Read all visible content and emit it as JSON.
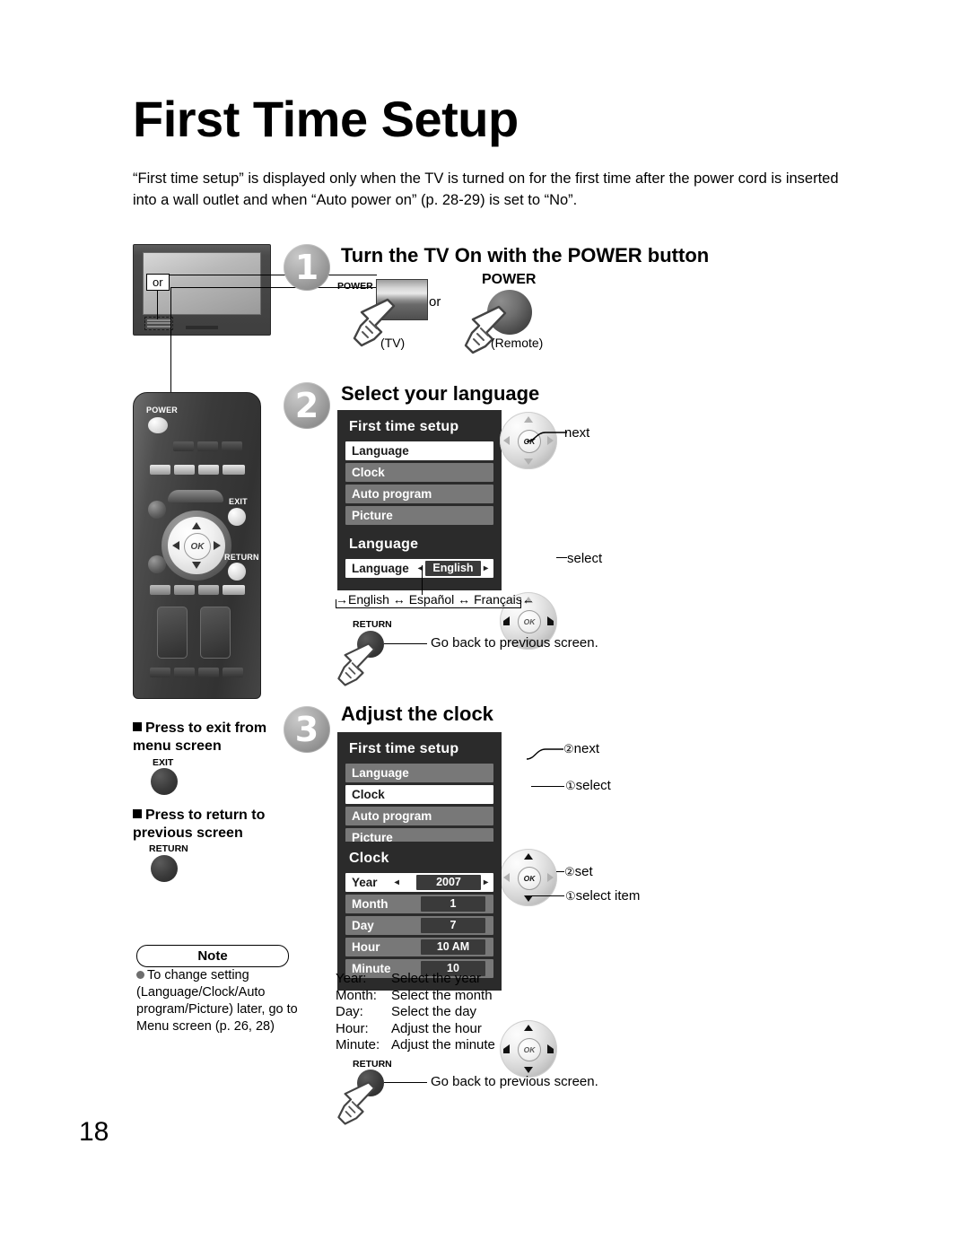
{
  "page": {
    "title": "First Time Setup",
    "intro": "“First time setup” is displayed only when the TV is turned on for the first time after the power cord is inserted into a wall outlet and when “Auto power on” (p. 28-29) is set to “No”.",
    "number": "18"
  },
  "steps": [
    {
      "num": "1",
      "title": "Turn the TV On with the POWER button"
    },
    {
      "num": "2",
      "title": "Select your language"
    },
    {
      "num": "3",
      "title": "Adjust the clock"
    }
  ],
  "step1": {
    "tv_or_label": "or",
    "tv_power_label": "POWER",
    "tv_caption": "(TV)",
    "or_text": "or",
    "remote_power_label": "POWER",
    "remote_caption": "(Remote)"
  },
  "step2": {
    "menu": {
      "title": "First time setup",
      "rows": [
        {
          "label": "Language",
          "selected": true
        },
        {
          "label": "Clock",
          "selected": false
        },
        {
          "label": "Auto program",
          "selected": false
        },
        {
          "label": "Picture",
          "selected": false
        }
      ]
    },
    "dpad_annotation": "next",
    "language_panel": {
      "title": "Language",
      "row_label": "Language",
      "row_value": "English",
      "left_arrow": "◂",
      "right_arrow": "▸"
    },
    "dpad_annotation2": "select",
    "language_chain": "English ↔ Español ↔ Français",
    "chain_in": "→",
    "chain_out": "←",
    "return_label": "RETURN",
    "return_text": "Go back to previous screen."
  },
  "step3": {
    "menu": {
      "title": "First time setup",
      "rows": [
        {
          "label": "Language",
          "selected": false
        },
        {
          "label": "Clock",
          "selected": true
        },
        {
          "label": "Auto program",
          "selected": false
        },
        {
          "label": "Picture",
          "selected": false
        }
      ]
    },
    "dpad_annotations": [
      {
        "num": "②",
        "text": "next"
      },
      {
        "num": "①",
        "text": "select"
      }
    ],
    "clock_panel": {
      "title": "Clock",
      "rows": [
        {
          "label": "Year",
          "value": "2007",
          "selected": true
        },
        {
          "label": "Month",
          "value": "1",
          "selected": false
        },
        {
          "label": "Day",
          "value": "7",
          "selected": false
        },
        {
          "label": "Hour",
          "value": "10 AM",
          "selected": false
        },
        {
          "label": "Minute",
          "value": "10",
          "selected": false
        }
      ]
    },
    "clock_dpad_annotations": [
      {
        "num": "②",
        "text": "set"
      },
      {
        "num": "①",
        "text": "select item"
      }
    ],
    "descriptions": [
      {
        "term": "Year:",
        "text": "Select the year"
      },
      {
        "term": "Month:",
        "text": "Select the month"
      },
      {
        "term": "Day:",
        "text": "Select the day"
      },
      {
        "term": "Hour:",
        "text": "Adjust the hour"
      },
      {
        "term": "Minute:",
        "text": "Adjust the minute"
      }
    ],
    "return_label": "RETURN",
    "return_text": "Go back to previous screen."
  },
  "left_column": {
    "remote_power_label": "POWER",
    "remote_exit_label": "EXIT",
    "remote_return_label": "RETURN",
    "remote_ok_label": "OK",
    "exit_bullet": "Press to exit from menu screen",
    "exit_button_label": "EXIT",
    "return_bullet": "Press to return to previous screen",
    "return_button_label": "RETURN",
    "note_title": "Note",
    "note_text": "To change setting (Language/Clock/Auto program/Picture) later, go to Menu screen (p. 26, 28)"
  },
  "colors": {
    "osd_bg": "#2b2b2b",
    "osd_row": "#787878",
    "osd_row_selected": "#ffffff",
    "osd_value": "#3a3a3a",
    "ink": "#000000"
  }
}
